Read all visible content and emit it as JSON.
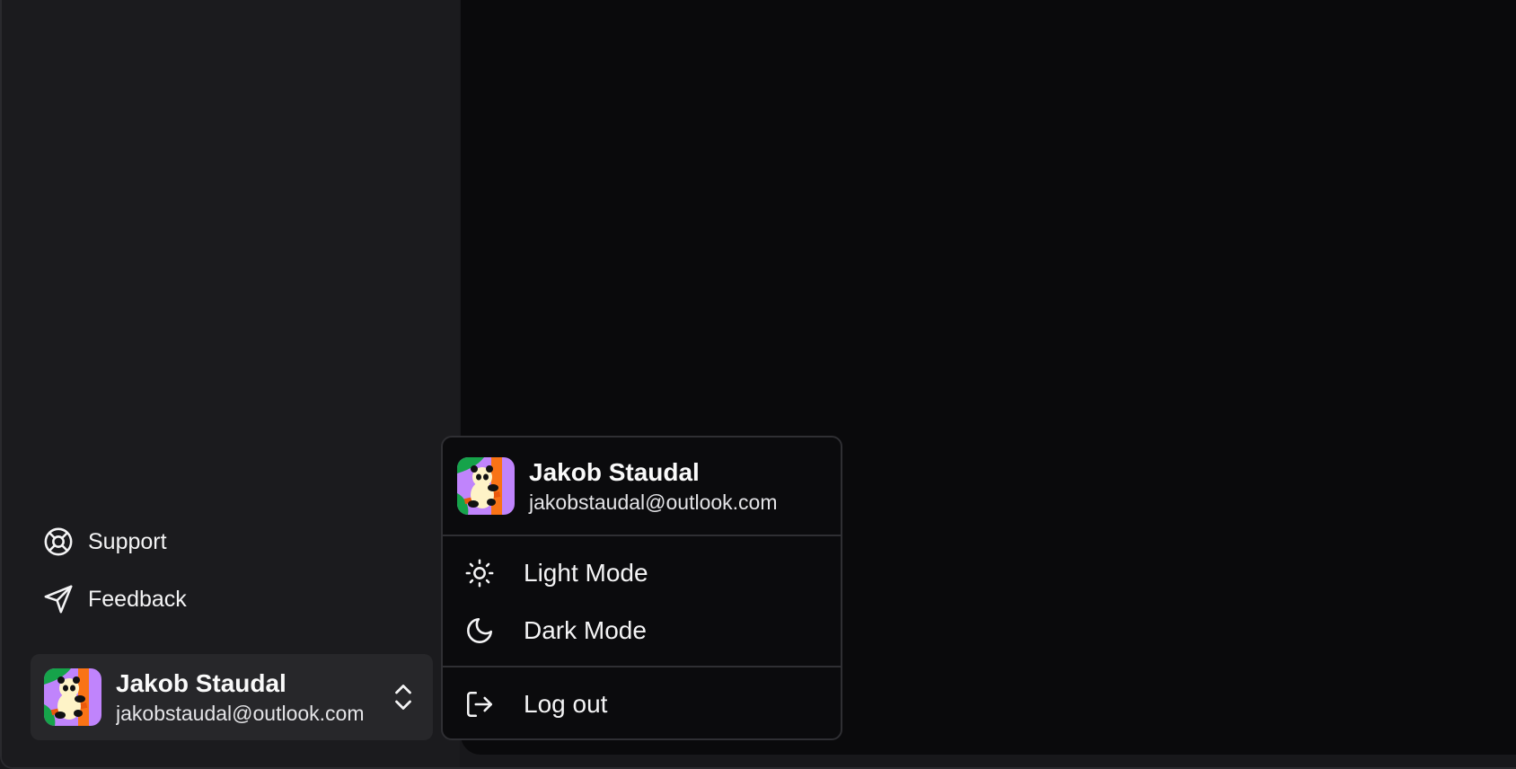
{
  "sidebar": {
    "nav": [
      {
        "label": "Support",
        "icon": "life-buoy-icon"
      },
      {
        "label": "Feedback",
        "icon": "send-icon"
      }
    ],
    "user": {
      "name": "Jakob Staudal",
      "email": "jakobstaudal@outlook.com",
      "avatar": "panda-avatar-icon"
    }
  },
  "menu": {
    "user": {
      "name": "Jakob Staudal",
      "email": "jakobstaudal@outlook.com"
    },
    "items": [
      {
        "label": "Light Mode",
        "icon": "sun-icon"
      },
      {
        "label": "Dark Mode",
        "icon": "moon-icon"
      },
      {
        "label": "Log out",
        "icon": "log-out-icon"
      }
    ]
  },
  "colors": {
    "sidebar_bg": "#1b1b1e",
    "main_bg": "#0a0a0c",
    "card_bg": "#27272a",
    "border": "#2f2f33",
    "text": "#fafafa"
  }
}
